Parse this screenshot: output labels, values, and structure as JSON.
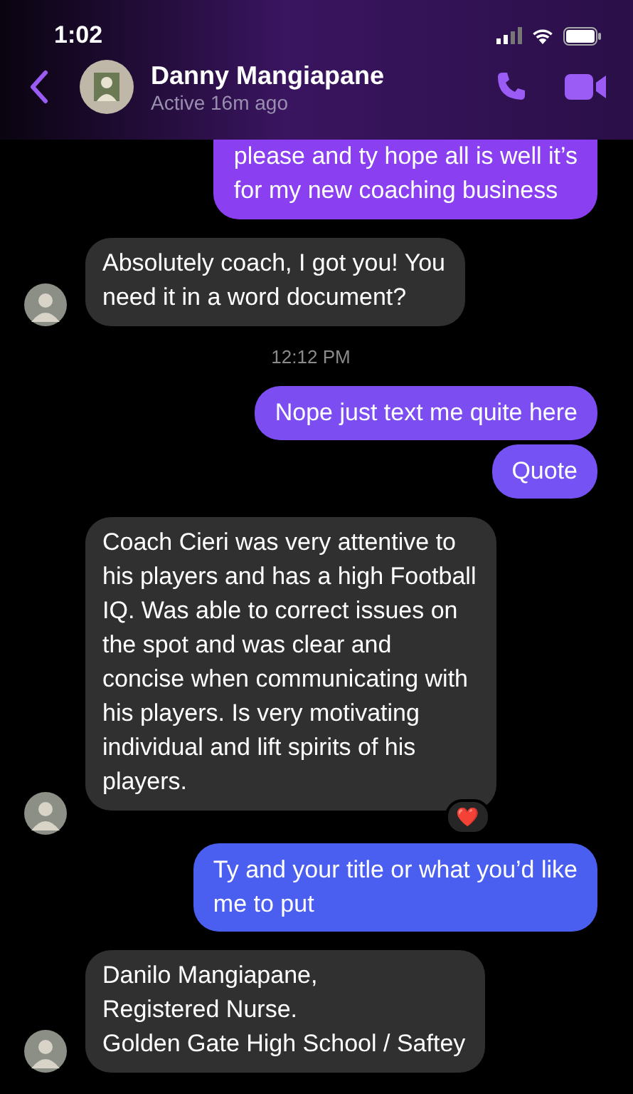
{
  "status_bar": {
    "time": "1:02"
  },
  "header": {
    "name": "Danny Mangiapane",
    "status": "Active 16m ago"
  },
  "messages": [
    {
      "kind": "sent",
      "color": "#8a3ff0",
      "lines": [
        "please and ty hope all is well it’s",
        "for my new coaching business"
      ]
    },
    {
      "kind": "received",
      "avatar": true,
      "lines": [
        "Absolutely coach, I got you! You",
        "need it in a word document?"
      ]
    },
    {
      "kind": "time",
      "lines": [
        "12:12 PM"
      ]
    },
    {
      "kind": "sent",
      "color": "#7c4ef2",
      "lines": [
        "Nope just text me quite here"
      ]
    },
    {
      "kind": "sent",
      "color": "#7552f3",
      "lines": [
        "Quote"
      ]
    },
    {
      "kind": "received",
      "avatar": true,
      "reaction": "❤️",
      "lines": [
        "Coach Cieri was very attentive to",
        "his players and has a high Football",
        "IQ. Was able to correct issues on",
        "the spot and was clear and",
        "concise when communicating with",
        "his players. Is very motivating",
        "individual and lift spirits of his",
        "players."
      ]
    },
    {
      "kind": "sent",
      "color": "#4a5ef0",
      "lines": [
        "Ty and your title or what you’d like",
        "me to put"
      ]
    },
    {
      "kind": "received",
      "avatar": true,
      "lines": [
        "Danilo Mangiapane,",
        "Registered Nurse.",
        "Golden Gate High School / Saftey"
      ]
    }
  ]
}
